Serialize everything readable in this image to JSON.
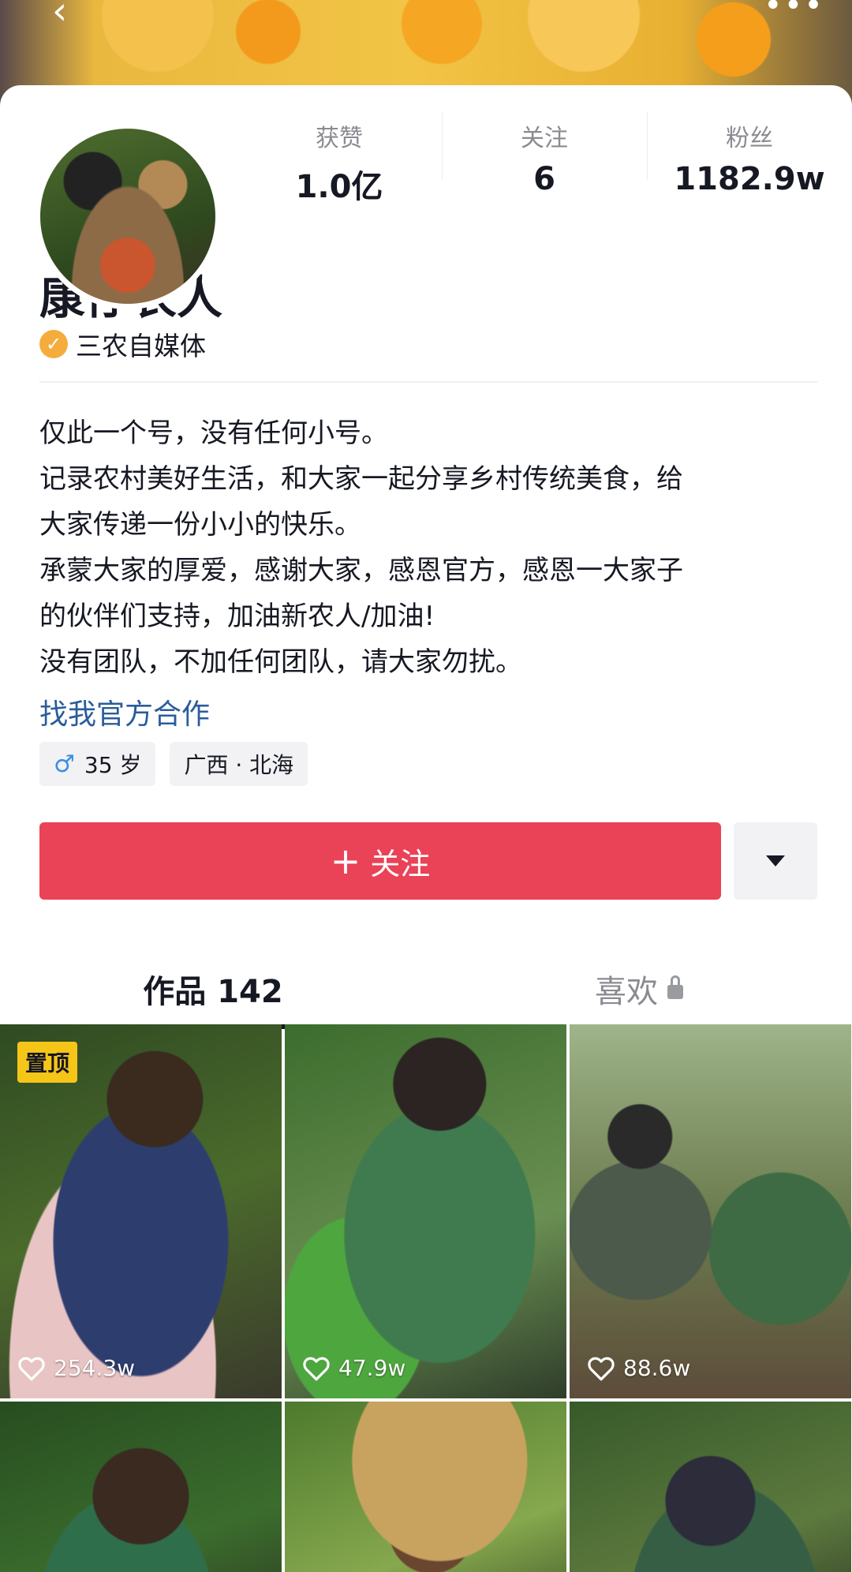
{
  "stats": [
    {
      "label": "获赞",
      "value": "1.0亿"
    },
    {
      "label": "关注",
      "value": "6"
    },
    {
      "label": "粉丝",
      "value": "1182.9w"
    }
  ],
  "profile": {
    "name": "康仔农人",
    "verified_label": "三农自媒体",
    "bio": [
      "仅此一个号，没有任何小号。",
      "记录农村美好生活，和大家一起分享乡村传统美食，给",
      "大家传递一份小小的快乐。",
      "承蒙大家的厚爱，感谢大家，感恩官方，感恩一大家子",
      "的伙伴们支持，加油新农人/加油!",
      "没有团队，不加任何团队，请大家勿扰。"
    ],
    "cooperation_link": "找我官方合作",
    "tags": {
      "age": "35 岁",
      "location": "广西 · 北海"
    }
  },
  "actions": {
    "follow_label": "关注"
  },
  "tabs": [
    {
      "label": "作品 142",
      "active": true
    },
    {
      "label": "喜欢",
      "active": false,
      "locked": true
    }
  ],
  "videos": [
    {
      "likes": "254.3w",
      "pinned_label": "置顶"
    },
    {
      "likes": "47.9w"
    },
    {
      "likes": "88.6w"
    },
    {},
    {},
    {}
  ],
  "colors": {
    "follow_button": "#ea4257",
    "link": "#2b5c9a",
    "pinned_badge": "#f5c518",
    "verified_badge": "#f4ad3d"
  }
}
